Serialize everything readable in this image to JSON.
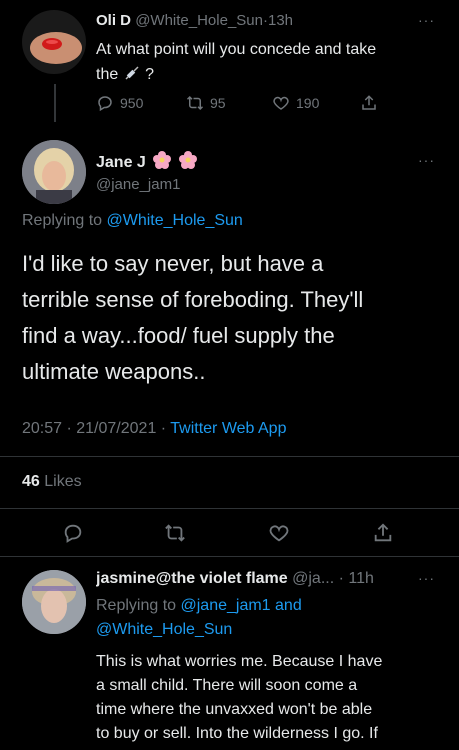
{
  "tweet1": {
    "name": "Oli D",
    "handle": "@White_Hole_Sun",
    "time": "13h",
    "text_line1": "At what point will you concede and take",
    "text_line2_pre": "the",
    "text_line2_post": "?",
    "replies": "950",
    "retweets": "95",
    "likes": "190"
  },
  "main": {
    "name": "Jane J",
    "handle": "@jane_jam1",
    "replying_prefix": "Replying to",
    "replying_user": "@White_Hole_Sun",
    "text_lines": [
      "I'd like to say never, but have a",
      "terrible sense of foreboding.  They'll",
      "find a way...food/ fuel supply the",
      "ultimate weapons.."
    ],
    "timestamp": "20:57 · 21/07/2021 ·",
    "source": "Twitter Web App",
    "likes_count": "46",
    "likes_label": "Likes"
  },
  "reply": {
    "name": "jasmine@the violet flame",
    "handle": "@ja...",
    "time": "· 11h",
    "replying_prefix": "Replying to",
    "replying_user1": "@jane_jam1",
    "replying_and": "and",
    "replying_user2": "@White_Hole_Sun",
    "text_lines": [
      "This is what worries me. Because I have",
      "a small child. There will soon come a",
      "time where the unvaxxed won't be able",
      "to buy or sell. Into the wilderness I go. If"
    ]
  },
  "colors": {
    "accent": "#1d9bf0",
    "muted": "#71767b",
    "text": "#e7e9ea",
    "background": "#000000"
  }
}
